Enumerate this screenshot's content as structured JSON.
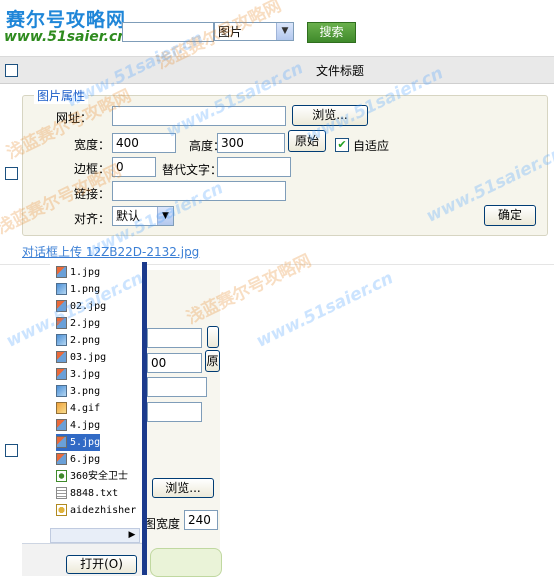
{
  "logo": {
    "title": "赛尔号攻略网",
    "url": "www.51saier.cn"
  },
  "search": {
    "type_value": "图片",
    "button_label": "搜索"
  },
  "list_header": {
    "title": "文件标题"
  },
  "image_props": {
    "legend": "图片属性",
    "url_label": "网址：",
    "browse_label": "浏览...",
    "width_label": "宽度：",
    "width_value": "400",
    "height_label": "高度：",
    "height_value": "300",
    "original_label": "原始",
    "auto_fit_label": "自适应",
    "border_label": "边框：",
    "border_value": "0",
    "alt_label": "替代文字：",
    "link_label": "链接：",
    "align_label": "对齐：",
    "align_value": "默认",
    "confirm_label": "确定"
  },
  "upload_caption": "对话框上传  12ZB22D-2132.jpg",
  "file_dialog": {
    "files": [
      {
        "name": "1.jpg",
        "icon": "jpg-icon"
      },
      {
        "name": "1.png",
        "icon": "png-icon"
      },
      {
        "name": "02.jpg",
        "icon": "jpg-icon"
      },
      {
        "name": "2.jpg",
        "icon": "jpg-icon"
      },
      {
        "name": "2.png",
        "icon": "png-icon"
      },
      {
        "name": "03.jpg",
        "icon": "jpg-icon"
      },
      {
        "name": "3.jpg",
        "icon": "jpg-icon"
      },
      {
        "name": "3.png",
        "icon": "png-icon"
      },
      {
        "name": "4.gif",
        "icon": "gif-icon"
      },
      {
        "name": "4.jpg",
        "icon": "jpg-icon"
      },
      {
        "name": "5.jpg",
        "icon": "jpg-icon",
        "selected": true
      },
      {
        "name": "6.jpg",
        "icon": "jpg-icon"
      },
      {
        "name": "360安全卫士",
        "icon": "app-icon"
      },
      {
        "name": "8848.txt",
        "icon": "txt-icon"
      },
      {
        "name": "aidezhisher",
        "icon": "music-icon"
      }
    ],
    "open_label": "打开(O)"
  },
  "lower_form": {
    "height_value_partial": "00",
    "original_partial": "原",
    "browse_label": "浏览...",
    "image_width_label": "图宽度",
    "image_width_value": "240"
  },
  "watermark": {
    "cn": "浅蓝赛尔号攻略网",
    "url": "www.51saier.cn"
  },
  "colors": {
    "search_button": "#4a9a36",
    "header_bg": "#e9e9e9",
    "panel_bg": "#f6f5ec",
    "legend_text": "#1a5cc8",
    "selection": "#316ac5"
  }
}
